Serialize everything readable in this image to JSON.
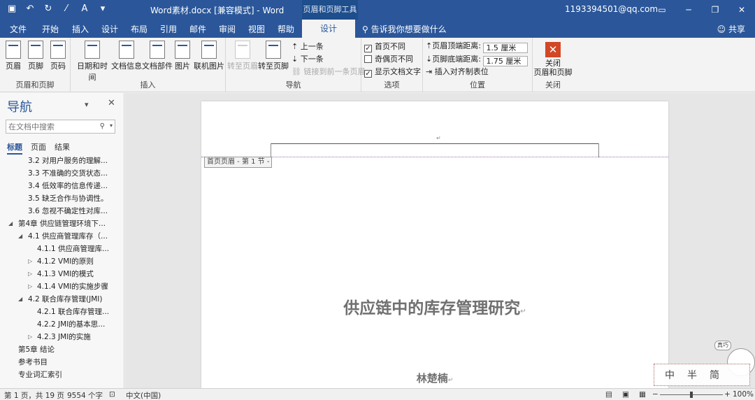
{
  "titlebar": {
    "doc_title": "Word素材.docx [兼容模式]  -  Word",
    "context_tool": "页眉和页脚工具",
    "account": "1193394501@qq.com",
    "qat_icons": [
      "save-icon",
      "undo-icon",
      "redo-icon",
      "touch-icon",
      "format-painter-icon",
      "customize-icon"
    ]
  },
  "tabs": {
    "items": [
      "文件",
      "开始",
      "插入",
      "设计",
      "布局",
      "引用",
      "邮件",
      "审阅",
      "视图",
      "帮助"
    ],
    "active": "设计",
    "tell_me": "告诉我你想要做什么",
    "share": "共享"
  },
  "ribbon": {
    "group_header_footer": {
      "label": "页眉和页脚",
      "header": "页眉",
      "footer": "页脚",
      "page_number": "页码"
    },
    "group_insert": {
      "label": "插入",
      "date_time": "日期和时间",
      "doc_info": "文档信息",
      "doc_parts": "文档部件",
      "picture": "图片",
      "online_picture": "联机图片"
    },
    "group_nav": {
      "label": "导航",
      "goto_header": "转至页眉",
      "goto_footer": "转至页脚",
      "previous": "上一条",
      "next": "下一条",
      "link_previous": "链接到前一条页眉"
    },
    "group_options": {
      "label": "选项",
      "different_first": "首页不同",
      "different_odd_even": "奇偶页不同",
      "show_doc_text": "显示文档文字",
      "different_first_checked": "✓",
      "show_doc_text_checked": "✓"
    },
    "group_position": {
      "label": "位置",
      "header_top_label": "页眉顶端距离:",
      "header_top_value": "1.5 厘米",
      "footer_bottom_label": "页脚底端距离:",
      "footer_bottom_value": "1.75 厘米",
      "insert_align_tab": "插入对齐制表位"
    },
    "group_close": {
      "label": "关闭",
      "close_button": "关闭\n页眉和页脚"
    }
  },
  "nav": {
    "title": "导航",
    "search_placeholder": "在文档中搜索",
    "tabs": [
      "标题",
      "页面",
      "结果"
    ],
    "items": [
      {
        "text": "3.2 对用户服务的理解...",
        "level": 2,
        "arrow": ""
      },
      {
        "text": "3.3 不准确的交货状态...",
        "level": 2,
        "arrow": ""
      },
      {
        "text": "3.4 低效率的信息传递...",
        "level": 2,
        "arrow": ""
      },
      {
        "text": "3.5 缺乏合作与协调性。",
        "level": 2,
        "arrow": ""
      },
      {
        "text": "3.6 忽视不确定性对库...",
        "level": 2,
        "arrow": ""
      },
      {
        "text": "第4章 供应链管理环境下...",
        "level": 1,
        "arrow": "◢"
      },
      {
        "text": "4.1 供应商管理库存（...",
        "level": 2,
        "arrow": "◢"
      },
      {
        "text": "4.1.1 供应商管理库...",
        "level": 3,
        "arrow": ""
      },
      {
        "text": "4.1.2 VMI的原则",
        "level": 3,
        "arrow": "▷"
      },
      {
        "text": "4.1.3 VMI的模式",
        "level": 3,
        "arrow": "▷"
      },
      {
        "text": "4.1.4 VMI的实施步骤",
        "level": 3,
        "arrow": "▷"
      },
      {
        "text": "4.2 联合库存管理(JMI)",
        "level": 2,
        "arrow": "◢"
      },
      {
        "text": "4.2.1 联合库存管理...",
        "level": 3,
        "arrow": ""
      },
      {
        "text": "4.2.2 JMI的基本思...",
        "level": 3,
        "arrow": ""
      },
      {
        "text": "4.2.3 JMI的实施",
        "level": 3,
        "arrow": "▷"
      },
      {
        "text": "第5章 结论",
        "level": 1,
        "arrow": ""
      },
      {
        "text": "参考书目",
        "level": 1,
        "arrow": ""
      },
      {
        "text": "专业词汇索引",
        "level": 1,
        "arrow": ""
      }
    ]
  },
  "document": {
    "header_tag": "首页页眉 - 第 1 节 -",
    "paragraph_mark": "↵",
    "heading": "供应链中的库存管理研究",
    "author": "林楚楠"
  },
  "watermark": {
    "chars": [
      "中",
      "半",
      "简"
    ],
    "tag": "真巧"
  },
  "status": {
    "page": "第 1 页，共 19 页",
    "words": "9554 个字",
    "language": "中文(中国)",
    "zoom": "100%"
  },
  "colors": {
    "brand": "#2b579a",
    "close_red": "#d24726"
  }
}
